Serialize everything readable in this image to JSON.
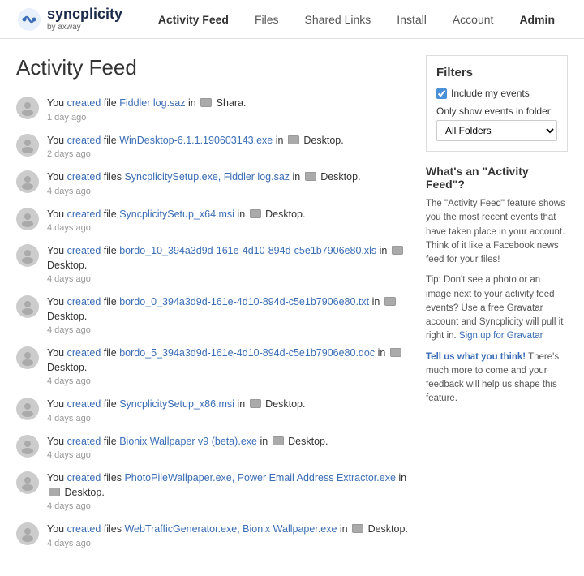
{
  "header": {
    "logo_main": "syncplicity",
    "logo_sub": "by axway",
    "nav_items": [
      {
        "label": "Activity Feed",
        "active": true
      },
      {
        "label": "Files",
        "active": false
      },
      {
        "label": "Shared Links",
        "active": false
      },
      {
        "label": "Install",
        "active": false
      },
      {
        "label": "Account",
        "active": false
      },
      {
        "label": "Admin",
        "active": false,
        "hovered": true
      }
    ]
  },
  "page": {
    "title": "Activity Feed"
  },
  "filters": {
    "title": "Filters",
    "include_my_events_label": "Include my events",
    "only_show_label": "Only show events in folder:",
    "folder_select_value": "All Folders",
    "folder_select_options": [
      "All Folders"
    ]
  },
  "what_box": {
    "title": "What's an \"Activity Feed\"?",
    "para1": "The \"Activity Feed\" feature shows you the most recent events that have taken place in your account. Think of it like a Facebook news feed for your files!",
    "para2_prefix": "Tip: Don't see a photo or an image next to your activity feed events? Use a free Gravatar account and Syncplicity will pull it right in.",
    "gravatar_link": "Sign up for Gravatar",
    "para3_prefix": "Tell us what you think!",
    "para3_suffix": " There's much more to come and your feedback will help us shape this feature."
  },
  "activities": [
    {
      "you": "You",
      "action": "created",
      "prefix": "file",
      "files": "Fiddler log.saz",
      "suffix": "in",
      "folder": "Shara.",
      "timestamp": "1 day ago"
    },
    {
      "you": "You",
      "action": "created",
      "prefix": "file",
      "files": "WinDesktop-6.1.1.190603143.exe",
      "suffix": "in",
      "folder": "Desktop.",
      "timestamp": "2 days ago"
    },
    {
      "you": "You",
      "action": "created",
      "prefix": "files",
      "files": "SyncplicitySetup.exe, Fiddler log.saz",
      "suffix": "in",
      "folder": "Desktop.",
      "timestamp": "4 days ago"
    },
    {
      "you": "You",
      "action": "created",
      "prefix": "file",
      "files": "SyncplicitySetup_x64.msi",
      "suffix": "in",
      "folder": "Desktop.",
      "timestamp": "4 days ago"
    },
    {
      "you": "You",
      "action": "created",
      "prefix": "file",
      "files": "bordo_10_394a3d9d-161e-4d10-894d-c5e1b7906e80.xls",
      "suffix": "in",
      "folder": "Desktop.",
      "timestamp": "4 days ago"
    },
    {
      "you": "You",
      "action": "created",
      "prefix": "file",
      "files": "bordo_0_394a3d9d-161e-4d10-894d-c5e1b7906e80.txt",
      "suffix": "in",
      "folder": "Desktop.",
      "timestamp": "4 days ago"
    },
    {
      "you": "You",
      "action": "created",
      "prefix": "file",
      "files": "bordo_5_394a3d9d-161e-4d10-894d-c5e1b7906e80.doc",
      "suffix": "in",
      "folder": "Desktop.",
      "timestamp": "4 days ago"
    },
    {
      "you": "You",
      "action": "created",
      "prefix": "file",
      "files": "SyncplicitySetup_x86.msi",
      "suffix": "in",
      "folder": "Desktop.",
      "timestamp": "4 days ago"
    },
    {
      "you": "You",
      "action": "created",
      "prefix": "file",
      "files": "Bionix Wallpaper v9 (beta).exe",
      "suffix": "in",
      "folder": "Desktop.",
      "timestamp": "4 days ago"
    },
    {
      "you": "You",
      "action": "created",
      "prefix": "files",
      "files": "PhotoPileWallpaper.exe, Power Email Address Extractor.exe",
      "suffix": "in",
      "folder": "Desktop.",
      "timestamp": "4 days ago"
    },
    {
      "you": "You",
      "action": "created",
      "prefix": "files",
      "files": "WebTrafficGenerator.exe, Bionix Wallpaper.exe",
      "suffix": "in",
      "folder": "Desktop.",
      "timestamp": "4 days ago"
    }
  ]
}
